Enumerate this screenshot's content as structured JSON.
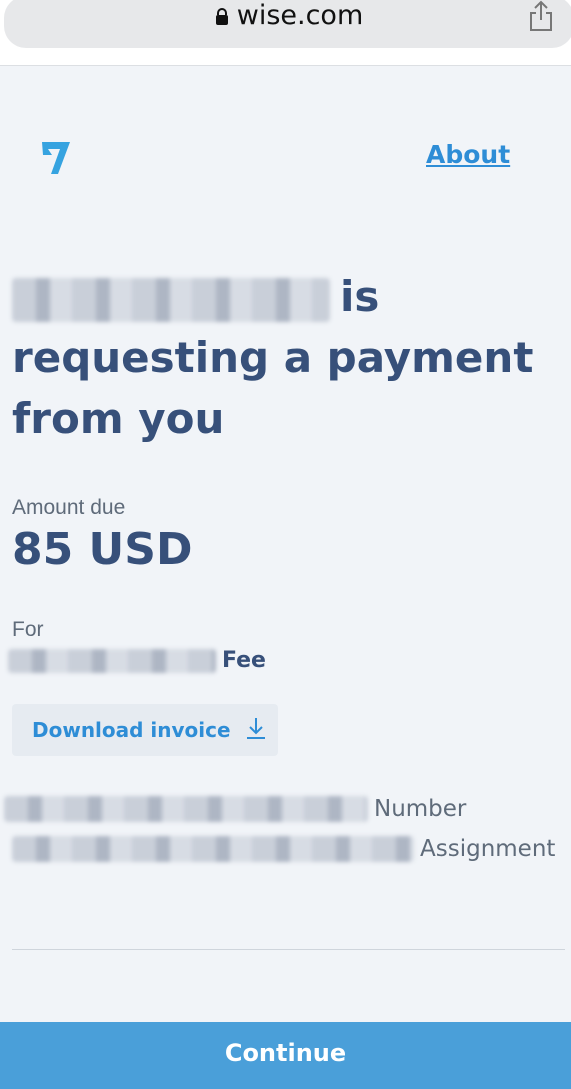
{
  "browser": {
    "url": "wise.com"
  },
  "header": {
    "about_label": "About"
  },
  "request": {
    "headline_after_name": "is requesting a payment from you",
    "amount_label": "Amount due",
    "amount_value": "85 USD",
    "for_label": "For",
    "for_value_suffix": "Fee",
    "download_label": "Download invoice",
    "note_line_1_suffix": "Number",
    "note_line_2_suffix": "Assignment"
  },
  "footer": {
    "continue_label": "Continue"
  },
  "colors": {
    "brand_blue": "#2e8dd6",
    "heading_navy": "#37507a",
    "continue_bg": "#4a9fd9",
    "page_bg": "#f1f4f8"
  },
  "icons": {
    "logo": "wise-logo-icon",
    "lock": "lock-icon",
    "share": "share-icon",
    "download": "download-arrow-icon"
  }
}
